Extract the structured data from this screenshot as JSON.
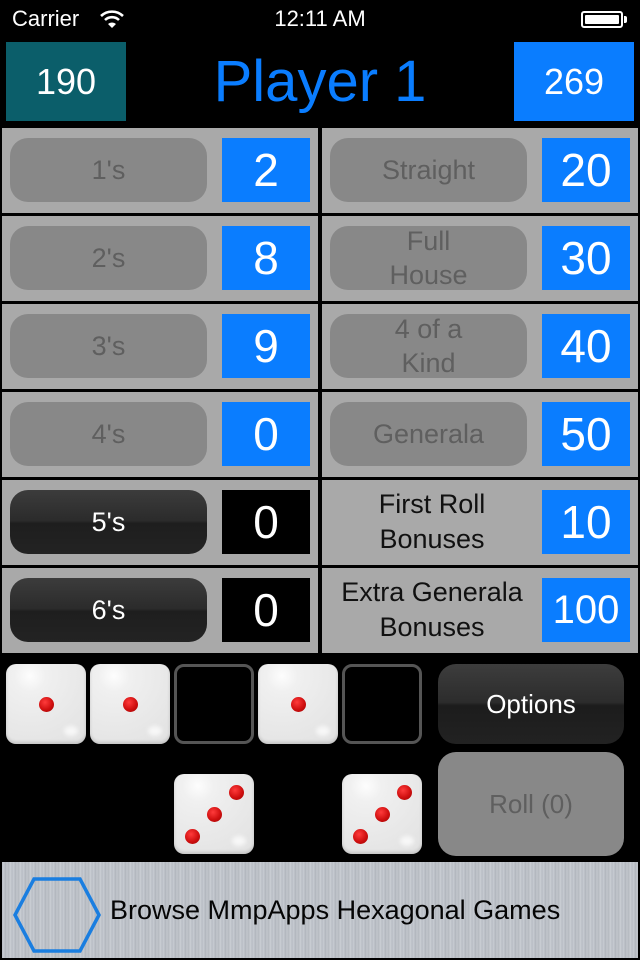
{
  "status_bar": {
    "carrier": "Carrier",
    "time": "12:11 AM",
    "wifi_icon": "wifi-icon",
    "battery_icon": "battery-full-icon"
  },
  "header": {
    "left_score": "190",
    "player_name": "Player 1",
    "right_score": "269",
    "colors": {
      "left_box": "#0b5e6a",
      "right_box": "#0a7dff",
      "title": "#0a7dff"
    }
  },
  "scorecard": {
    "upper": [
      {
        "label": "1's",
        "score": "2",
        "state": "used"
      },
      {
        "label": "2's",
        "score": "8",
        "state": "used"
      },
      {
        "label": "3's",
        "score": "9",
        "state": "used"
      },
      {
        "label": "4's",
        "score": "0",
        "state": "used"
      },
      {
        "label": "5's",
        "score": "0",
        "state": "open"
      },
      {
        "label": "6's",
        "score": "0",
        "state": "open"
      }
    ],
    "lower": [
      {
        "label": "Straight",
        "score": "20",
        "state": "used"
      },
      {
        "label": "Full House",
        "score": "30",
        "state": "used"
      },
      {
        "label": "4 of a Kind",
        "score": "40",
        "state": "used"
      },
      {
        "label": "Generala",
        "score": "50",
        "state": "used"
      },
      {
        "label": "First Roll Bonuses",
        "score": "10",
        "state": "label"
      },
      {
        "label": "Extra Generala Bonuses",
        "score": "100",
        "state": "label"
      }
    ]
  },
  "dice": {
    "held_row": [
      1,
      1,
      null,
      1,
      null
    ],
    "rolled_row": [
      null,
      null,
      3,
      null,
      3
    ]
  },
  "buttons": {
    "options": "Options",
    "roll": "Roll (0)"
  },
  "banner": {
    "text": "Browse MmpApps Hexagonal Games",
    "icon": "hexagon-icon",
    "icon_color": "#1a7ee0"
  }
}
